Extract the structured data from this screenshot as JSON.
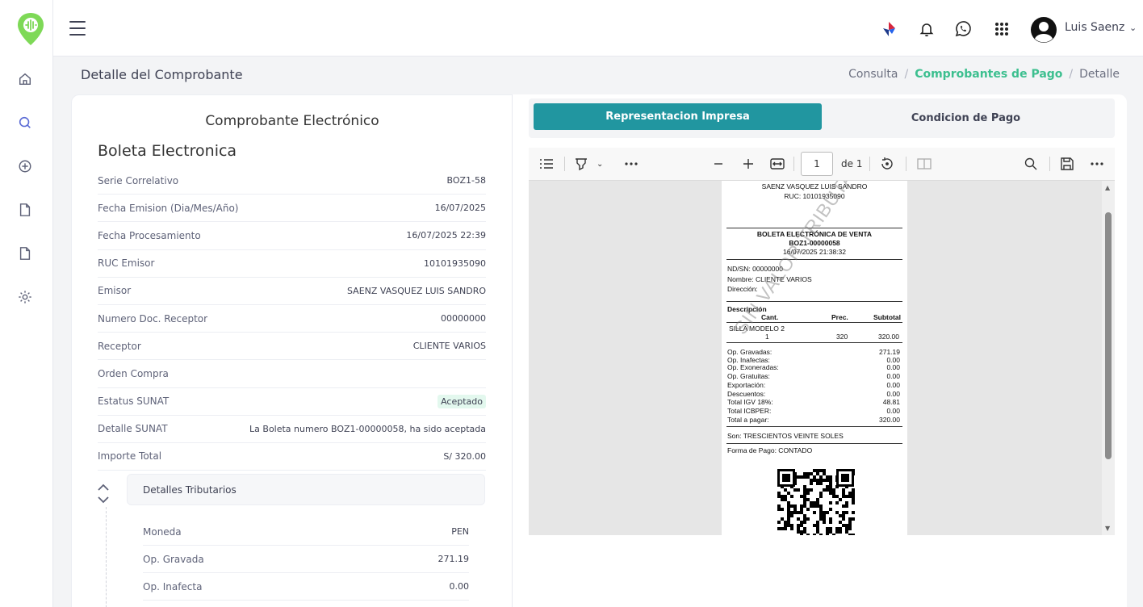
{
  "user": {
    "name": "Luis Saenz"
  },
  "page": {
    "title": "Detalle del Comprobante"
  },
  "breadcrumb": [
    "Consulta",
    "Comprobantes de Pago",
    "Detalle"
  ],
  "card": {
    "title": "Comprobante Electrónico",
    "doc_type": "Boleta Electronica",
    "rows": [
      {
        "label": "Serie Correlativo",
        "value": "BOZ1-58"
      },
      {
        "label": "Fecha Emision (Dia/Mes/Año)",
        "value": "16/07/2025"
      },
      {
        "label": "Fecha Procesamiento",
        "value": "16/07/2025 22:39"
      },
      {
        "label": "RUC Emisor",
        "value": "10101935090"
      },
      {
        "label": "Emisor",
        "value": "SAENZ VASQUEZ LUIS SANDRO"
      },
      {
        "label": "Numero Doc. Receptor",
        "value": "00000000"
      },
      {
        "label": "Receptor",
        "value": "CLIENTE VARIOS"
      },
      {
        "label": "Orden Compra",
        "value": ""
      },
      {
        "label": "Estatus SUNAT",
        "value": "Aceptado"
      },
      {
        "label": "Detalle SUNAT",
        "value": "La Boleta numero BOZ1-00000058, ha sido aceptada"
      },
      {
        "label": "Importe Total",
        "value": "S/ 320.00"
      }
    ],
    "tributarios": {
      "title": "Detalles Tributarios",
      "rows": [
        {
          "label": "Moneda",
          "value": "PEN"
        },
        {
          "label": "Op. Gravada",
          "value": "271.19"
        },
        {
          "label": "Op. Inafecta",
          "value": "0.00"
        }
      ]
    }
  },
  "tabs": {
    "active": "Representacion Impresa",
    "other": "Condicion de Pago"
  },
  "viewer": {
    "page": "1",
    "of": "de 1"
  },
  "receipt": {
    "issuer": "SAENZ VASQUEZ LUIS SANDRO",
    "ruc": "RUC: 10101935090",
    "doc_title": "BOLETA ELECTRÓNICA DE VENTA",
    "doc_number": "BOZ1-00000058",
    "datetime": "16/07/2025 21:38:32",
    "nd": "ND/SN: 00000000",
    "nombre": "Nombre: CLIENTE VARIOS",
    "direccion": "Dirección:",
    "desc_header": "Descripción",
    "col_cant": "Cant.",
    "col_prec": "Prec.",
    "col_subtotal": "Subtotal",
    "item_name": "SILLA MODELO 2",
    "item_cant": "1",
    "item_prec": "320",
    "item_subtotal": "320.00",
    "totals": [
      {
        "label": "Op. Gravadas:",
        "value": "271.19"
      },
      {
        "label": "Op. Inafectas:",
        "value": "0.00"
      },
      {
        "label": "Op. Exoneradas:",
        "value": "0.00"
      },
      {
        "label": "Op. Gratuitas:",
        "value": "0.00"
      },
      {
        "label": "Exportación:",
        "value": "0.00"
      },
      {
        "label": "Descuentos:",
        "value": "0.00"
      },
      {
        "label": "Total IGV 18%:",
        "value": "48.81"
      },
      {
        "label": "Total ICBPER:",
        "value": "0.00"
      },
      {
        "label": "Total a pagar:",
        "value": "320.00"
      }
    ],
    "son": "Son: TRESCIENTOS VEINTE SOLES",
    "forma_pago": "Forma de Pago: CONTADO",
    "watermark": "SIN VALOR TRIBUTARIO"
  },
  "colors": {
    "accent": "#2196a0",
    "green": "#3cbf8f",
    "brand_logo": "#7ed957"
  }
}
